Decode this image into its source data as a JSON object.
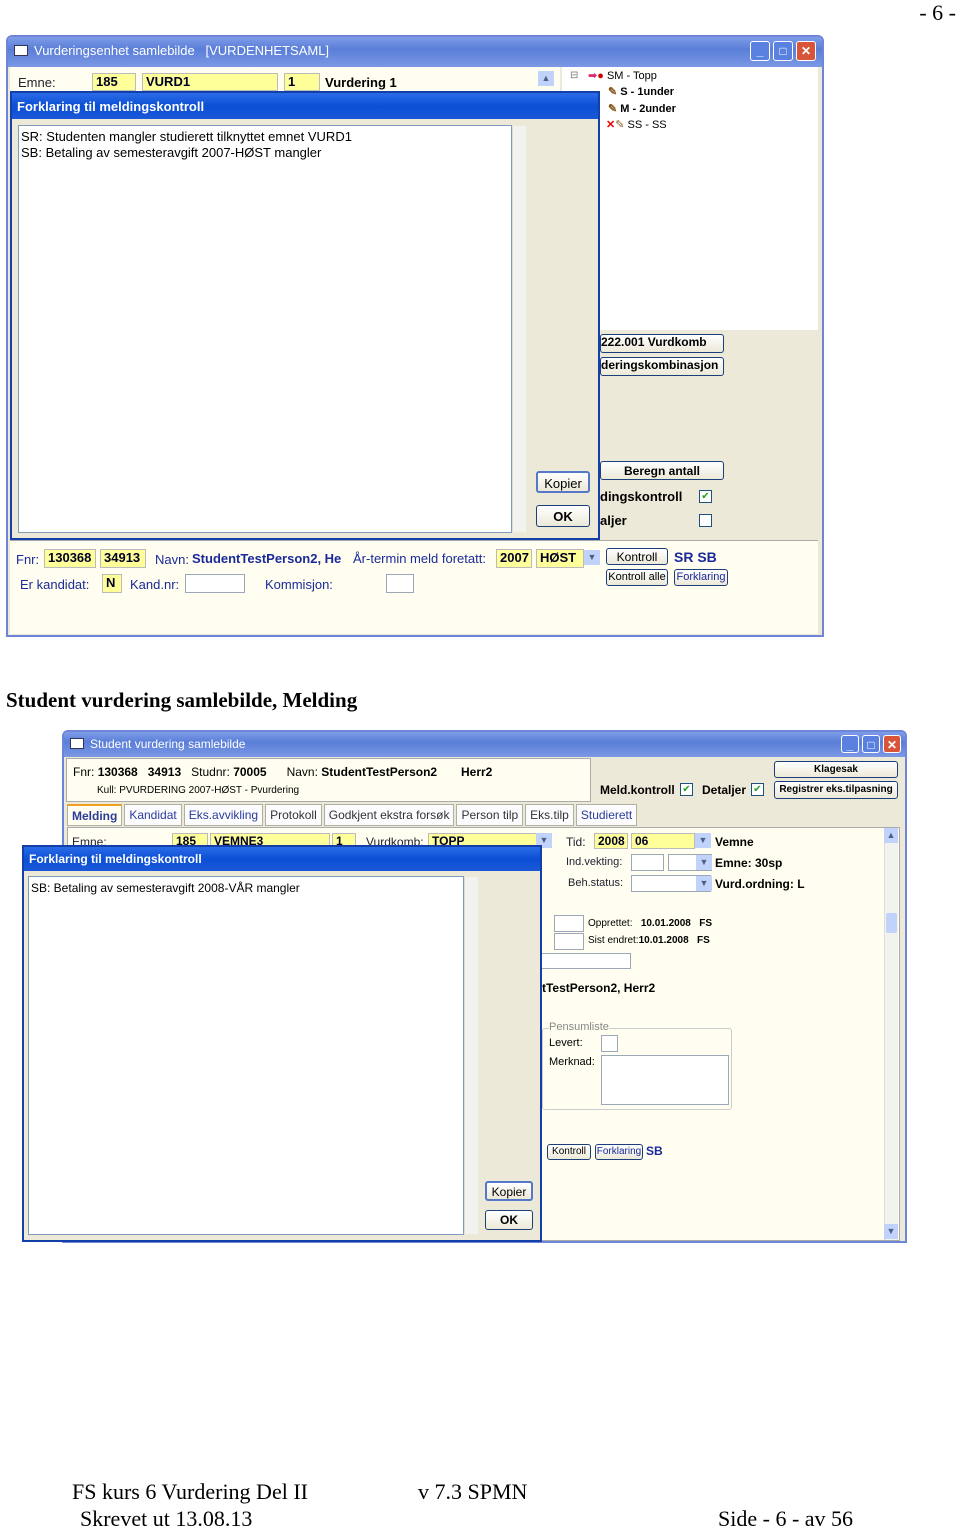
{
  "page_header": "- 6 -",
  "window1": {
    "title": "Vurderingsenhet samlebilde",
    "title_code": "[VURDENHETSAML]",
    "emne_label": "Emne:",
    "emne_code": "185",
    "emne_name": "VURD1",
    "vurd_nr": "1",
    "vurd_name": "Vurdering 1",
    "tree": [
      {
        "label": "SM - Topp",
        "icon": "apple-icon"
      },
      {
        "label": "S - 1under",
        "icon": "pencil-icon"
      },
      {
        "label": "M - 2under",
        "icon": "pencil-icon"
      },
      {
        "label": "SS - SS",
        "icon": "pencil-icon"
      }
    ],
    "btn_vurdkomb": "222.001 Vurdkomb",
    "btn_kombinasjon": "deringskombinasjon",
    "btn_beregn": "Beregn antall",
    "chk_meldingskontroll": "dingskontroll",
    "chk_meldingskontroll_checked": true,
    "chk_detaljer": "aljer",
    "chk_detaljer_checked": false,
    "fnr_label": "Fnr:",
    "fnr1": "130368",
    "fnr2": "34913",
    "navn_label": "Navn:",
    "navn": "StudentTestPerson2, He",
    "arterm_label": "År-termin meld foretatt:",
    "ar": "2007",
    "termin": "HØST",
    "btn_kontroll": "Kontroll",
    "status_codes": "SR SB",
    "btn_kontroll_alle": "Kontroll alle",
    "btn_forklaring": "Forklaring",
    "kandidat_label": "Er kandidat:",
    "kandidat": "N",
    "kandnr_label": "Kand.nr:",
    "kommisjon_label": "Kommisjon:",
    "dialog": {
      "title": "Forklaring til meldingskontroll",
      "lines": [
        "SR: Studenten mangler studierett tilknyttet emnet VURD1",
        "SB: Betaling av semesteravgift 2007-HØST mangler"
      ],
      "kopier": "Kopier",
      "ok": "OK"
    }
  },
  "caption": "Student vurdering samlebilde, Melding",
  "window2": {
    "title": "Student vurdering samlebilde",
    "fnr_label": "Fnr:",
    "fnr": "130368",
    "fnr2": "34913",
    "studnr_label": "Studnr:",
    "studnr": "70005",
    "navn_label": "Navn:",
    "navn": "StudentTestPerson2",
    "navn2": "Herr2",
    "kull": "Kull: PVURDERING 2007-HØST - Pvurdering",
    "meld_kontroll": "Meld.kontroll",
    "detaljer": "Detaljer",
    "btn_klagesak": "Klagesak",
    "btn_registrer": "Registrer eks.tilpasning",
    "tabs": [
      "Melding",
      "Kandidat",
      "Eks.avvikling",
      "Protokoll",
      "Godkjent ekstra forsøk",
      "Person tilp",
      "Eks.tilp",
      "Studierett"
    ],
    "emne_label": "Emne:",
    "emne_code": "185",
    "emne_name": "VEMNE3",
    "emne_nr": "1",
    "vurdkomb_label": "Vurdkomb:",
    "vurdkomb": "TOPP",
    "tid_label": "Tid:",
    "tid_ar": "2008",
    "tid_mnd": "06",
    "vemne": "Vemne",
    "indvekting_label": "Ind.vekting:",
    "emne_sp": "Emne: 30sp",
    "behstatus_label": "Beh.status:",
    "vurdordning": "Vurd.ordning: L",
    "opprettet_label": "Opprettet:",
    "opprettet": "10.01.2008",
    "opprettet_by": "FS",
    "sist_endret_label": "Sist endret:",
    "sist_endret": "10.01.2008",
    "sist_endret_by": "FS",
    "person_name": "tTestPerson2, Herr2",
    "pensumliste": "Pensumliste",
    "levert_label": "Levert:",
    "merknad_label": "Merknad:",
    "btn_kontroll": "Kontroll",
    "btn_forklaring": "Forklaring",
    "status_codes": "SB",
    "dialog": {
      "title": "Forklaring til meldingskontroll",
      "lines": [
        "SB: Betaling av semesteravgift 2008-VÅR mangler"
      ],
      "kopier": "Kopier",
      "ok": "OK"
    }
  },
  "footer": {
    "course": "FS kurs 6 Vurdering Del II",
    "version": "v 7.3 SPMN",
    "printed": "Skrevet ut 13.08.13",
    "page": "Side - 6 - av 56"
  },
  "colors": {
    "titlebar": "#5a7ed8",
    "dialog_titlebar": "#0b4fd4",
    "field_yellow": "#ffff99",
    "panel": "#fffef0",
    "accent_text": "#1a2a9a"
  }
}
